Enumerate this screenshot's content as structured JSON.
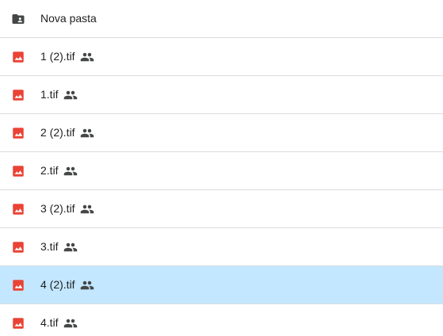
{
  "colors": {
    "selected_background": "#c2e7ff",
    "image_icon": "#ea4335",
    "folder_icon": "#444746",
    "divider": "#dadce0"
  },
  "items": [
    {
      "name": "Nova pasta",
      "type": "folder",
      "icon": "shared-folder-icon",
      "shared": false,
      "selected": false
    },
    {
      "name": "1 (2).tif",
      "type": "image",
      "icon": "image-file-icon",
      "shared": true,
      "selected": false
    },
    {
      "name": "1.tif",
      "type": "image",
      "icon": "image-file-icon",
      "shared": true,
      "selected": false
    },
    {
      "name": "2 (2).tif",
      "type": "image",
      "icon": "image-file-icon",
      "shared": true,
      "selected": false
    },
    {
      "name": "2.tif",
      "type": "image",
      "icon": "image-file-icon",
      "shared": true,
      "selected": false
    },
    {
      "name": "3 (2).tif",
      "type": "image",
      "icon": "image-file-icon",
      "shared": true,
      "selected": false
    },
    {
      "name": "3.tif",
      "type": "image",
      "icon": "image-file-icon",
      "shared": true,
      "selected": false
    },
    {
      "name": "4 (2).tif",
      "type": "image",
      "icon": "image-file-icon",
      "shared": true,
      "selected": true
    },
    {
      "name": "4.tif",
      "type": "image",
      "icon": "image-file-icon",
      "shared": true,
      "selected": false
    }
  ]
}
